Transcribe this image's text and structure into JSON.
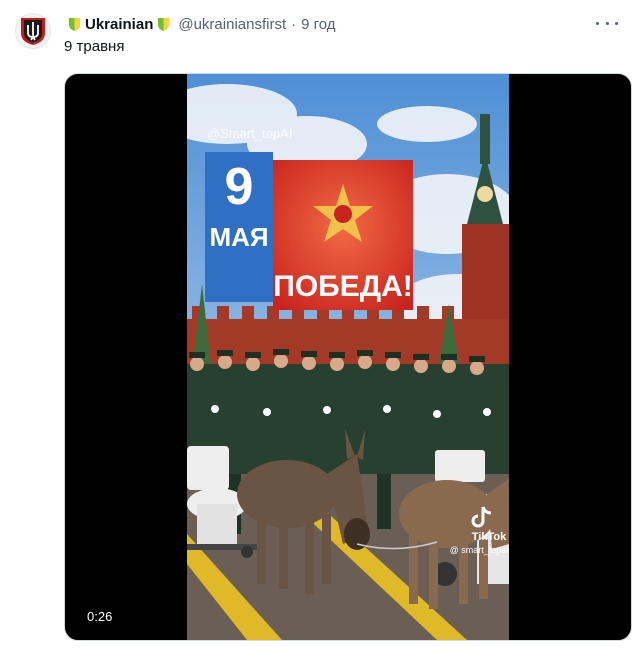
{
  "tweet": {
    "display_name": "Ukrainian",
    "handle": "@ukrainiansfirst",
    "separator": "·",
    "time": "9 год",
    "text": "9 травня"
  },
  "video": {
    "duration": "0:26",
    "watermark": "@Smart_topAI",
    "banner_date_number": "9",
    "banner_date_month": "МАЯ",
    "banner_slogan": "ПОБЕДА!",
    "tiktok_label": "TikTok",
    "tiktok_user": "@ smart_topai"
  },
  "colors": {
    "badge_green": "#6fbf3a",
    "badge_blue": "#4aa3df",
    "banner_red": "#d8322a",
    "banner_blue": "#2f6fc4"
  }
}
